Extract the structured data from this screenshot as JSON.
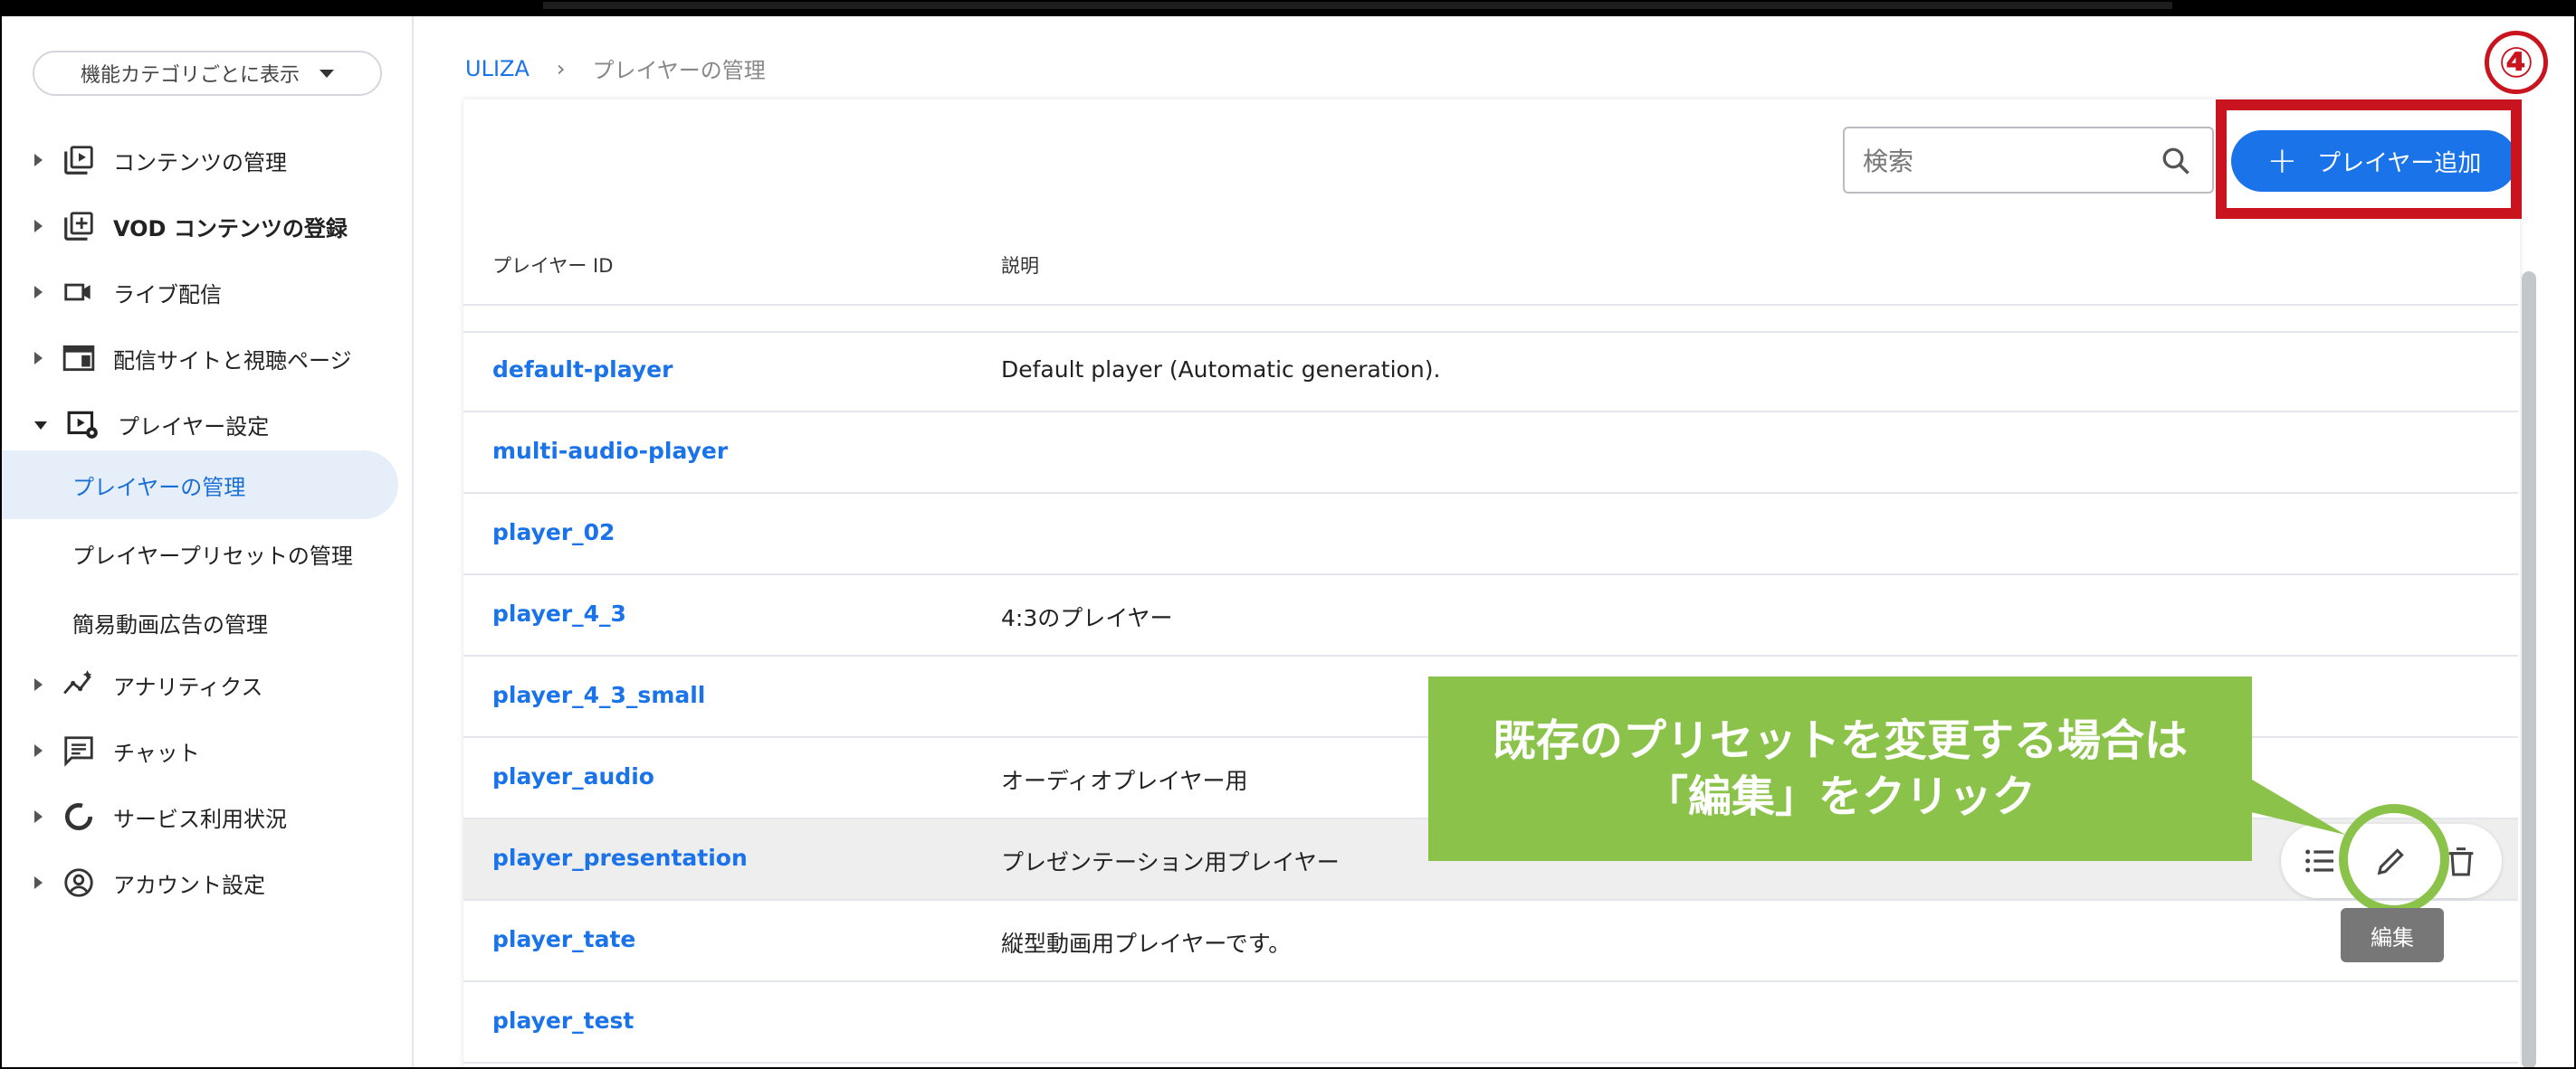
{
  "sidebar": {
    "category_label": "機能カテゴリごとに表示",
    "items": [
      {
        "label": "コンテンツの管理",
        "icon": "play-list-icon"
      },
      {
        "label": "VOD コンテンツの登録",
        "icon": "add-box-icon"
      },
      {
        "label": "ライブ配信",
        "icon": "video-camera-icon"
      },
      {
        "label": "配信サイトと視聴ページ",
        "icon": "web-page-icon"
      },
      {
        "label": "プレイヤー設定",
        "icon": "player-settings-icon"
      },
      {
        "label": "アナリティクス",
        "icon": "analytics-icon"
      },
      {
        "label": "チャット",
        "icon": "chat-icon"
      },
      {
        "label": "サービス利用状況",
        "icon": "usage-ring-icon"
      },
      {
        "label": "アカウント設定",
        "icon": "account-icon"
      }
    ],
    "subitems": [
      {
        "label": "プレイヤーの管理",
        "active": true
      },
      {
        "label": "プレイヤープリセットの管理",
        "active": false
      },
      {
        "label": "簡易動画広告の管理",
        "active": false
      }
    ]
  },
  "breadcrumb": {
    "root": "ULIZA",
    "separator": "›",
    "current": "プレイヤーの管理"
  },
  "toolbar": {
    "search_placeholder": "検索",
    "add_label": "プレイヤー追加",
    "add_icon": "+"
  },
  "step_badge": "④",
  "table": {
    "headers": [
      "プレイヤー ID",
      "説明"
    ],
    "rows": [
      {
        "id": "default-player",
        "desc": "Default player (Automatic generation)."
      },
      {
        "id": "multi-audio-player",
        "desc": ""
      },
      {
        "id": "player_02",
        "desc": ""
      },
      {
        "id": "player_4_3",
        "desc": "4:3のプレイヤー"
      },
      {
        "id": "player_4_3_small",
        "desc": ""
      },
      {
        "id": "player_audio",
        "desc": "オーディオプレイヤー用"
      },
      {
        "id": "player_presentation",
        "desc": "プレゼンテーション用プレイヤー"
      },
      {
        "id": "player_tate",
        "desc": "縦型動画用プレイヤーです。"
      },
      {
        "id": "player_test",
        "desc": ""
      }
    ]
  },
  "tooltip": "編集",
  "callout": {
    "line1": "既存のプリセットを変更する場合は",
    "line2": "「編集」をクリック"
  },
  "colors": {
    "accent": "#1a73e8",
    "highlight_red": "#c9131e",
    "callout_green": "#8bc34a"
  }
}
